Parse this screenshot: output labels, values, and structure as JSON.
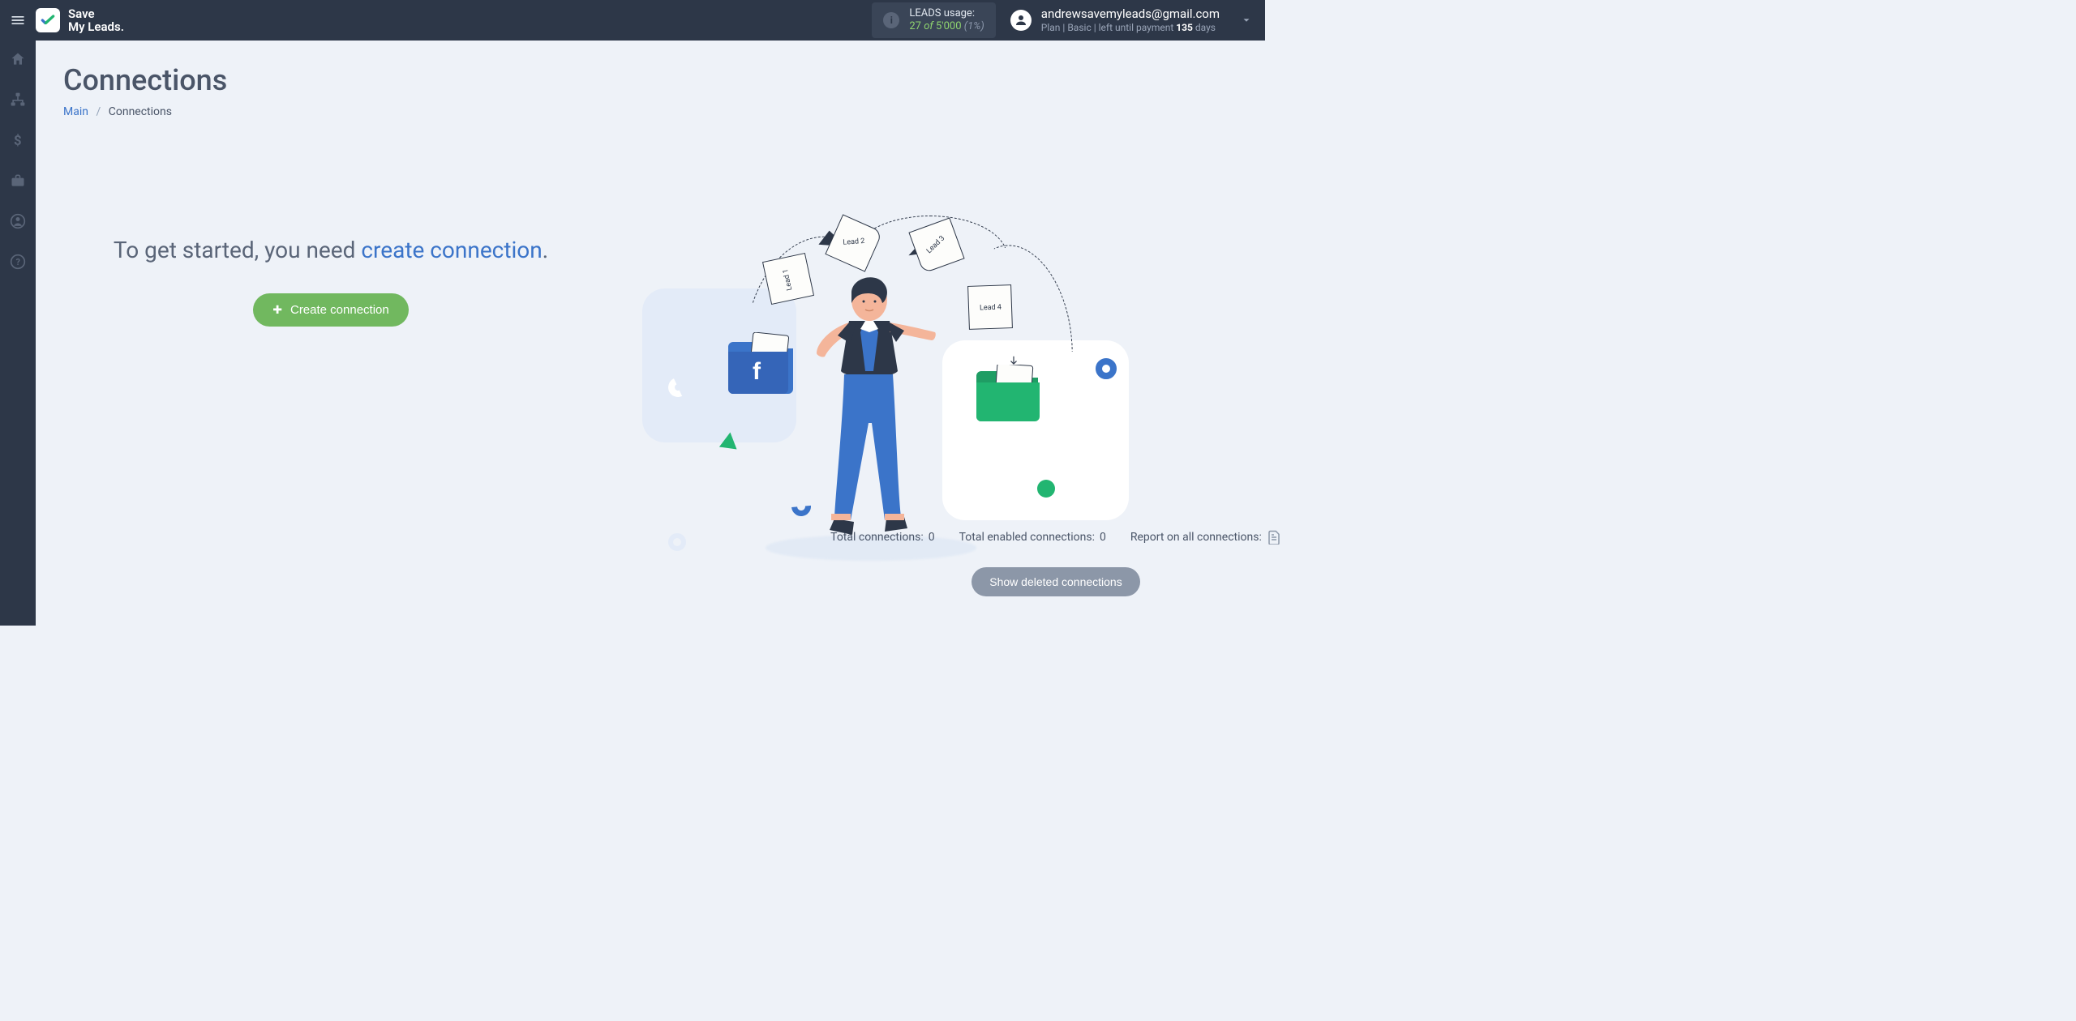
{
  "brand": {
    "line1": "Save",
    "line2": "My Leads."
  },
  "usage": {
    "label": "LEADS usage:",
    "current": "27",
    "of": "of",
    "limit": "5'000",
    "percent": "(1%)"
  },
  "account": {
    "email": "andrewsavemyleads@gmail.com",
    "plan_prefix": "Plan |",
    "plan_name": "Basic",
    "plan_middle": "| left until payment",
    "days": "135",
    "days_suffix": "days"
  },
  "page": {
    "title": "Connections",
    "breadcrumb_main": "Main",
    "breadcrumb_current": "Connections"
  },
  "hero": {
    "msg_prefix": "To get started, you need ",
    "msg_link": "create connection",
    "msg_suffix": ".",
    "button": "Create connection"
  },
  "illustration": {
    "lead1": "Lead 1",
    "lead2": "Lead 2",
    "lead3": "Lead 3",
    "lead4": "Lead 4",
    "fb": "f"
  },
  "stats": {
    "total_label": "Total connections:",
    "total_value": "0",
    "enabled_label": "Total enabled connections:",
    "enabled_value": "0",
    "report_label": "Report on all connections:"
  },
  "deleted_button": "Show deleted connections"
}
